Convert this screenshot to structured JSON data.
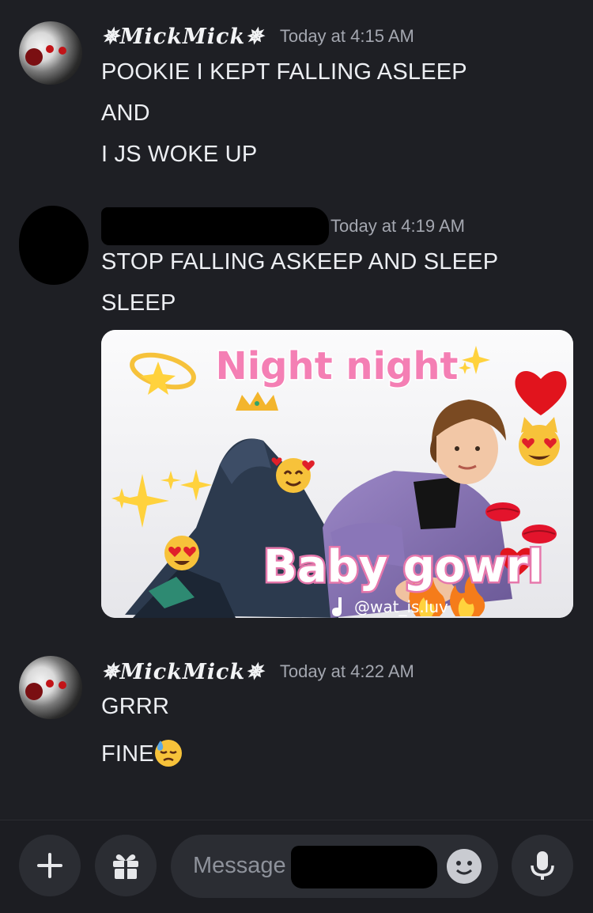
{
  "messages": [
    {
      "author": "✵MickMick✵",
      "timestamp": "Today at 4:15 AM",
      "lines": [
        "POOKIE I KEPT FALLING ASLEEP",
        "AND",
        "I JS WOKE UP"
      ]
    },
    {
      "author": "",
      "timestamp": "Today at 4:19 AM",
      "lines": [
        "STOP FALLING ASKEEP AND SLEEP",
        "SLEEP"
      ],
      "attachment": {
        "title": "Night night",
        "caption": "Baby gowrl",
        "watermark": "@wat_is.luv"
      }
    },
    {
      "author": "✵MickMick✵",
      "timestamp": "Today at 4:22 AM",
      "lines": [
        "GRRR",
        "FINE"
      ]
    }
  ],
  "composer": {
    "placeholder": "Message"
  },
  "icons": {
    "add": "plus-icon",
    "gift": "gift-icon",
    "emoji": "emoji-icon",
    "voice": "microphone-icon",
    "inline_emoji": "downcast-sweat-emoji"
  },
  "colors": {
    "background": "#1e1f24",
    "composer_field": "#2b2d33",
    "timestamp": "#a4a7b0",
    "caption_pink": "#f47fb4"
  }
}
